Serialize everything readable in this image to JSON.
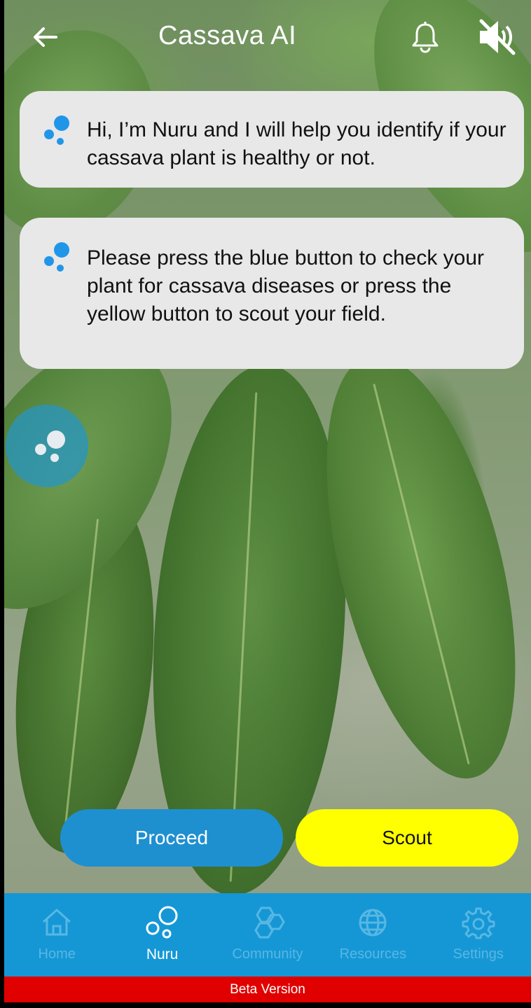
{
  "header": {
    "title": "Cassava AI",
    "back_icon": "arrow-left-icon",
    "notifications_icon": "bell-icon",
    "sound_icon": "speaker-muted-icon"
  },
  "chat": {
    "messages": [
      {
        "text": "Hi, I’m Nuru and I will help you identify if your cassava plant is healthy or not."
      },
      {
        "text": "Please press the blue button to check your plant for cassava diseases or press the yellow button to scout your field."
      }
    ]
  },
  "actions": {
    "proceed_label": "Proceed",
    "scout_label": "Scout"
  },
  "bottom_nav": {
    "items": [
      {
        "label": "Home",
        "icon": "home-icon",
        "active": false
      },
      {
        "label": "Nuru",
        "icon": "nuru-bubbles-icon",
        "active": true
      },
      {
        "label": "Community",
        "icon": "community-hexagons-icon",
        "active": false
      },
      {
        "label": "Resources",
        "icon": "globe-icon",
        "active": false
      },
      {
        "label": "Settings",
        "icon": "gear-icon",
        "active": false
      }
    ]
  },
  "footer": {
    "beta_label": "Beta Version"
  },
  "colors": {
    "accent_blue": "#1e90d0",
    "scout_yellow": "#ffff00",
    "nav_blue": "#1597d6",
    "beta_red": "#e00000",
    "bubble_bg": "#e8e8e8"
  }
}
